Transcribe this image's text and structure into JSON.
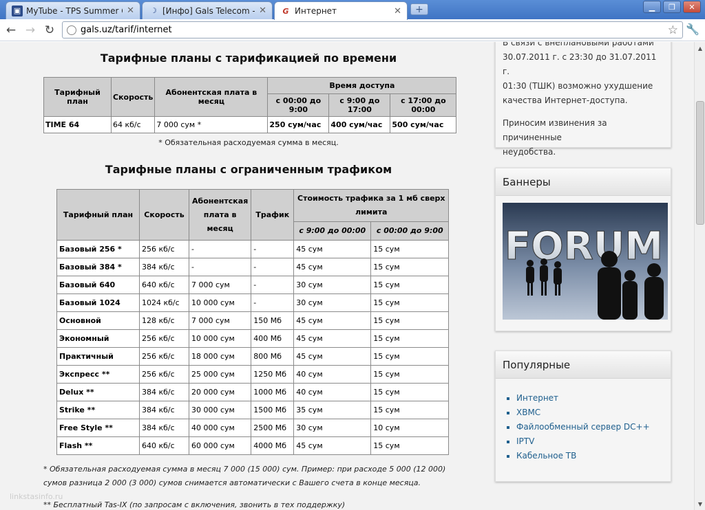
{
  "browser": {
    "tabs": [
      {
        "title": "MyTube - TPS Summer Cup...",
        "icon": "mytube-icon"
      },
      {
        "title": "[Инфо] Gals Telecom - Стр...",
        "icon": "moon-icon"
      },
      {
        "title": "Интернет",
        "icon": "gals-logo-icon"
      }
    ],
    "url": "gals.uz/tarif/internet"
  },
  "time_plans": {
    "title": "Тарифные планы с тарификацией по времени",
    "headers": {
      "plan": "Тарифный план",
      "speed": "Скорость",
      "fee": "Абонентская плата в месяц",
      "access": "Время доступа",
      "slot1": "с 00:00 до 9:00",
      "slot2": "с 9:00 до 17:00",
      "slot3": "с 17:00 до 00:00"
    },
    "row": {
      "plan": "TIME 64",
      "speed": "64 кб/с",
      "fee": "7 000 сум *",
      "p1": "250 сум/час",
      "p2": "400 сум/час",
      "p3": "500 сум/час"
    },
    "note": "* Обязательная расходуемая сумма в месяц."
  },
  "traffic_plans": {
    "title": "Тарифные планы с ограниченным трафиком",
    "headers": {
      "plan": "Тарифный план",
      "speed": "Скорость",
      "fee": "Абонентская плата в месяц",
      "traffic": "Трафик",
      "cost": "Стоимость трафика за 1 мб сверх лимита",
      "slot1": "с 9:00 до 00:00",
      "slot2": "с 00:00 до 9:00"
    },
    "rows": [
      [
        "Базовый 256 *",
        "256 кб/с",
        "-",
        "-",
        "45 сум",
        "15 сум"
      ],
      [
        "Базовый 384 *",
        "384 кб/с",
        "-",
        "-",
        "45 сум",
        "15 сум"
      ],
      [
        "Базовый 640",
        "640 кб/с",
        "7 000 сум",
        "-",
        "30 сум",
        "15 сум"
      ],
      [
        "Базовый 1024",
        "1024 кб/с",
        "10 000 сум",
        "-",
        "30 сум",
        "15 сум"
      ],
      [
        "Основной",
        "128 кб/с",
        "7 000 сум",
        "150 Мб",
        "45 сум",
        "15 сум"
      ],
      [
        "Экономный",
        "256 кб/с",
        "10 000 сум",
        "400 Мб",
        "45 сум",
        "15 сум"
      ],
      [
        "Практичный",
        "256 кб/с",
        "18 000 сум",
        "800 Мб",
        "45 сум",
        "15 сум"
      ],
      [
        "Экспресс **",
        "256 кб/с",
        "25 000 сум",
        "1250 Мб",
        "40 сум",
        "15 сум"
      ],
      [
        "Delux **",
        "384 кб/с",
        "20 000 сум",
        "1000 Мб",
        "40 сум",
        "15 сум"
      ],
      [
        "Strike **",
        "384 кб/с",
        "30 000 сум",
        "1500 Мб",
        "35 сум",
        "15 сум"
      ],
      [
        "Free Style **",
        "384 кб/с",
        "40 000 сум",
        "2500 Мб",
        "30 сум",
        "10 сум"
      ],
      [
        "Flash **",
        "640 кб/с",
        "60 000 сум",
        "4000 Мб",
        "45 сум",
        "15 сум"
      ]
    ],
    "note1": "* Обязательная расходуемая сумма в месяц 7 000 (15 000) сум. Пример: при расходе 5 000 (12 000)",
    "note2": "сумов разница 2 000 (3 000) сумов снимается автоматически с Вашего счета в конце месяца.",
    "note3": "** Бесплатный Tas-IX (по запросам с включения, звонить в тех поддержку)"
  },
  "sidebar": {
    "notice_lines": [
      "В связи с внеплановыми работами",
      "30.07.2011 г. с 23:30 до 31.07.2011 г.",
      "01:30 (ТШК) возможно ухудшение",
      "качества Интернет-доступа."
    ],
    "notice2_lines": [
      "Приносим извинения за причиненные",
      "неудобства."
    ],
    "banners_title": "Баннеры",
    "banner_text": "FORUM",
    "popular_title": "Популярные",
    "popular_links": [
      "Интернет",
      "ХВМС",
      "Файлообменный сервер DC++",
      "IPTV",
      "Кабельное ТВ"
    ]
  },
  "watermark": "linkstasinfo.ru"
}
